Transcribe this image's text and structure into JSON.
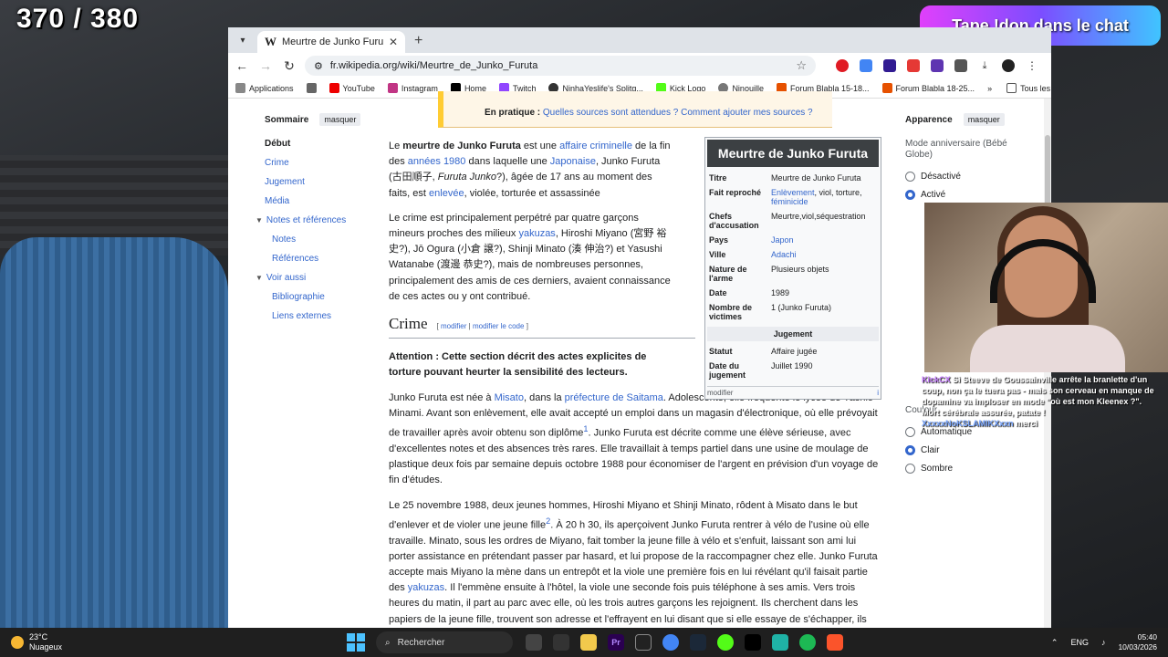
{
  "stream": {
    "counter": "370 / 380",
    "banner": "Tape !don dans le chat"
  },
  "browser": {
    "tab_title": "Meurtre de Junko Furuta — Wi",
    "tab_favicon": "W",
    "url": "fr.wikipedia.org/wiki/Meurtre_de_Junko_Furuta",
    "bookmarks": [
      "Applications",
      "YouTube",
      "Instagram",
      "Home",
      "Twitch",
      "NinhaYeslife's Splitg...",
      "Kick Logo",
      "Ninouille",
      "Forum Blabla 15-18...",
      "Forum Blabla 18-25..."
    ],
    "bookmarks_more": "»",
    "all_favorites": "Tous les favoris"
  },
  "notice": {
    "label": "En pratique :",
    "link": "Quelles sources sont attendues ? Comment ajouter mes sources ?"
  },
  "toc": {
    "title": "Sommaire",
    "hide": "masquer",
    "items": [
      "Début",
      "Crime",
      "Jugement",
      "Média",
      "Notes et références",
      "Notes",
      "Références",
      "Voir aussi",
      "Bibliographie",
      "Liens externes"
    ]
  },
  "article": {
    "p1_a": "Le ",
    "p1_bold": "meurtre de Junko Furuta",
    "p1_b": " est une ",
    "p1_link1": "affaire criminelle",
    "p1_c": " de la fin des ",
    "p1_link2": "années 1980",
    "p1_d": " dans laquelle une ",
    "p1_link3": "Japonaise",
    "p1_e": ", Junko Furuta (古田順子, ",
    "p1_it": "Furuta Junko",
    "p1_f": "?), âgée de 17 ans au moment des faits, est ",
    "p1_link4": "enlevée",
    "p1_g": ", violée, torturée et assassinée",
    "p2_a": "Le crime est principalement perpétré par quatre garçons mineurs proches des milieux ",
    "p2_link": "yakuzas",
    "p2_b": ", Hiroshi Miyano (宮野 裕史?), Jō Ogura (小倉 譲?), Shinji Minato (湊 伸治?) et Yasushi Watanabe (渡邊 恭史?), mais de nombreuses personnes, principalement des amis de ces derniers, avaient connaissance de ces actes ou y ont contribué.",
    "h2": "Crime",
    "edit_open": "[",
    "edit1": "modifier",
    "edit_sep": "|",
    "edit2": "modifier le code",
    "edit_close": "]",
    "warning": "Attention : Cette section décrit des actes explicites de torture pouvant heurter la sensibilité des lecteurs.",
    "p3_a": "Junko Furuta est née à ",
    "p3_link1": "Misato",
    "p3_b": ", dans la ",
    "p3_link2": "préfecture de Saitama",
    "p3_c": ". Adolescente, elle fréquente le lycée de Yashio-Minami. Avant son enlèvement, elle avait accepté un emploi dans un magasin d'électronique, où elle prévoyait de travailler après avoir obtenu son diplôme",
    "p3_sup": "1",
    "p3_d": ". Junko Furuta est décrite comme une élève sérieuse, avec d'excellentes notes et des absences très rares. Elle travaillait à temps partiel dans une usine de moulage de plastique deux fois par semaine depuis octobre 1988 pour économiser de l'argent en prévision d'un voyage de fin d'études.",
    "p4_a": "Le 25 novembre 1988, deux jeunes hommes, Hiroshi Miyano et Shinji Minato, rôdent à Misato dans le but d'enlever et de violer une jeune fille",
    "p4_sup": "2",
    "p4_b": ". À 20 h 30, ils aperçoivent Junko Furuta rentrer à vélo de l'usine où elle travaille. Minato, sous les ordres de Miyano, fait tomber la jeune fille à vélo et s'enfuit, laissant son ami lui porter assistance en prétendant passer par hasard, et lui propose de la raccompagner chez elle. Junko Furuta accepte mais Miyano la mène dans un entrepôt et la viole une première fois en lui révélant qu'il faisait partie des ",
    "p4_link": "yakuzas",
    "p4_c": ". Il l'emmène ensuite à l'hôtel, la viole une seconde fois puis téléphone à ses amis. Vers trois heures du matin, il part au parc avec elle, où les trois autres garçons les rejoignent. Ils cherchent dans les papiers de la jeune fille, trouvent son adresse et l'effrayent en lui disant que si elle essaye de s'échapper, ils enverront des yakuzas tuer sa"
  },
  "infobox": {
    "title": "Meurtre de Junko Furuta",
    "rows": [
      {
        "k": "Titre",
        "v": "Meurtre de Junko Furuta"
      },
      {
        "k": "Fait reproché",
        "v_link": "Enlèvement",
        "v": ", viol, torture, ",
        "v_link2": "féminicide"
      },
      {
        "k": "Chefs d'accusation",
        "v": "Meurtre,viol,séquestration"
      },
      {
        "k": "Pays",
        "v_link": "Japon"
      },
      {
        "k": "Ville",
        "v_link": "Adachi"
      },
      {
        "k": "Nature de l'arme",
        "v": "Plusieurs objets"
      },
      {
        "k": "Date",
        "v": "1989"
      },
      {
        "k": "Nombre de victimes",
        "v": "1 (Junko Furuta)"
      }
    ],
    "section": "Jugement",
    "rows2": [
      {
        "k": "Statut",
        "v": "Affaire jugée"
      },
      {
        "k": "Date du jugement",
        "v": "Juillet 1990"
      }
    ],
    "footer": "modifier",
    "info_icon": "i"
  },
  "appearance": {
    "title": "Apparence",
    "hide": "masquer",
    "mode_label": "Mode anniversaire (Bébé Globe)",
    "mode_options": [
      "Désactivé",
      "Activé"
    ],
    "color_label": "Couleur",
    "color_options": [
      "Automatique",
      "Clair",
      "Sombre"
    ]
  },
  "chat": {
    "user1": "KickCX",
    "msg1": " Si Steeve de Goussainville arrête la branlette d'un coup, non ça le tuera pas - mais son cerveau en manque de dopamine va imploser en mode \"où est mon Kleenex ?\". Mort cérébrale assurée, patate !",
    "user2": "XxxxxNoKSLAMIKXxxn",
    "msg2": " merci"
  },
  "taskbar": {
    "temp": "23°C",
    "weather": "Nuageux",
    "search": "Rechercher",
    "lang": "ENG",
    "time": "05:40",
    "date": "10/03/2026"
  }
}
